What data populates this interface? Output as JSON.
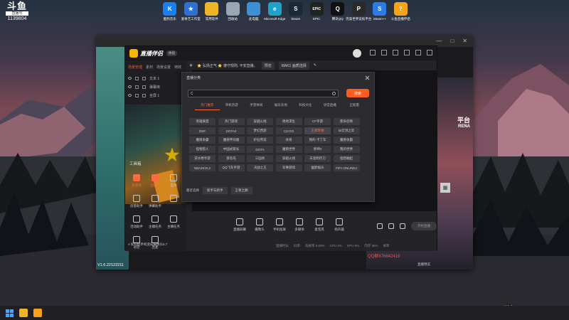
{
  "overlay": {
    "logo_text": "斗鱼",
    "logo_tag": "直播号",
    "room_id": "1139804",
    "watermark": "QQ群876642419"
  },
  "desktop_icons": [
    {
      "label": "酷狗音乐",
      "icon": "kugou-icon",
      "color": "#1a7ff0",
      "glyph": "K"
    },
    {
      "label": "爱奇艺工作室",
      "icon": "star-app-icon",
      "color": "#2f6fd8",
      "glyph": "★"
    },
    {
      "label": "常用软件",
      "icon": "folder-icon",
      "color": "#f0b429",
      "glyph": ""
    },
    {
      "label": "回收站",
      "icon": "recycle-bin-icon",
      "color": "#9aa6b4",
      "glyph": ""
    },
    {
      "label": "此电脑",
      "icon": "computer-icon",
      "color": "#3d8fd6",
      "glyph": ""
    },
    {
      "label": "Microsoft Edge",
      "icon": "edge-icon",
      "color": "#1fa3c9",
      "glyph": "e"
    },
    {
      "label": "Steam",
      "icon": "steam-icon",
      "color": "#1b2838",
      "glyph": "S"
    },
    {
      "label": "EPIC",
      "icon": "epic-games-icon",
      "color": "#222222",
      "glyph": "EPIC"
    },
    {
      "label": "腾讯QQ",
      "icon": "qq-icon",
      "color": "#111111",
      "glyph": "Q"
    },
    {
      "label": "完美世界竞技平台",
      "icon": "perfect-world-icon",
      "color": "#2a2a2a",
      "glyph": "P"
    },
    {
      "label": "Steam++",
      "icon": "steampp-icon",
      "color": "#2a7be4",
      "glyph": "S"
    },
    {
      "label": "斗鱼直播伴侣",
      "icon": "douyu-companion-icon",
      "color": "#f7a21b",
      "glyph": "?"
    }
  ],
  "app": {
    "name": "直播伴侣",
    "badge": "体验",
    "version": "V1.6.22122211",
    "left_tabs": [
      "场景管理",
      "素材",
      "场景设置",
      "特效"
    ],
    "layers": [
      {
        "label": "文本 1"
      },
      {
        "label": "弹幕库"
      },
      {
        "label": "全屏 1"
      }
    ],
    "toolbox_title": "工具箱",
    "tools": [
      {
        "label": "抖音号",
        "active": true
      },
      {
        "label": "创意屏",
        "active": true
      },
      {
        "label": "互动"
      },
      {
        "label": "房管助手"
      },
      {
        "label": "弹幕助手"
      },
      {
        "label": ""
      },
      {
        "label": "活动助手"
      },
      {
        "label": "主播任务"
      },
      {
        "label": "主播任务"
      },
      {
        "label": "语音"
      },
      {
        "label": "连麦"
      }
    ],
    "bottom_hint": "如何把手机变成摄像头5.7",
    "topbar": {
      "notice": "⭐ 弘扬正气 ⭐ 遵守规则, 平安直播。",
      "chip1": "预览",
      "chip2": "MAK1 画质选择"
    },
    "bottom_tools": [
      {
        "label": "直播屏幕",
        "icon": "screen-icon"
      },
      {
        "label": "摄像头",
        "icon": "camera-icon"
      },
      {
        "label": "手机投屏",
        "icon": "phone-icon"
      },
      {
        "label": "多媒体",
        "icon": "media-icon"
      },
      {
        "label": "麦克风",
        "icon": "mic-icon"
      },
      {
        "label": "扬声器",
        "icon": "speaker-icon"
      }
    ],
    "golive_label": "开始直播",
    "stats": [
      "直播时长",
      "码率",
      "丢帧率 0.00%",
      "CPU 2%",
      "GPU 0%",
      "内存 36%",
      "帧率"
    ]
  },
  "dialog": {
    "title": "直播分类",
    "search_value": "C",
    "search_button": "搜索",
    "tabs": [
      "热门推荐",
      "单机热游",
      "手游休闲",
      "娱乐天地",
      "科技文化",
      "语音直播",
      "正能量"
    ],
    "active_tab": 0,
    "categories": [
      "英雄联盟",
      "热门游戏",
      "穿越火线",
      "绝地求生",
      "CF手游",
      "使命召唤",
      "DNF",
      "DOTA2",
      "梦幻西游",
      "CS:GO",
      "王者荣耀",
      "lol云顶之弈",
      "魔兽争霸",
      "魔兽怀旧服",
      "炉石传说",
      "体育",
      "我的·卡丁车",
      "魔兽争霸",
      "怪物猎人",
      "中国式家长",
      "DOTA",
      "魔兽世界",
      "原神3",
      "我的世界",
      "逆水寒手游",
      "冒险岛",
      "三国杀",
      "穿越火线",
      "天涯明月刀",
      "怪猎崛起",
      "NBA2KOL2",
      "QQ飞车手游",
      "决战之王",
      "军事游戏",
      "幽默娱乐",
      "FIFA ONLINE4"
    ],
    "hover_index": 10,
    "recent_label": "最近选择",
    "recent": [
      "新手与新手",
      "王者之巅"
    ]
  },
  "right_preview": {
    "title_line1": "平台",
    "title_line2": "RENA",
    "red_text": "QQ群876642419",
    "sub_text": "直播预览"
  }
}
